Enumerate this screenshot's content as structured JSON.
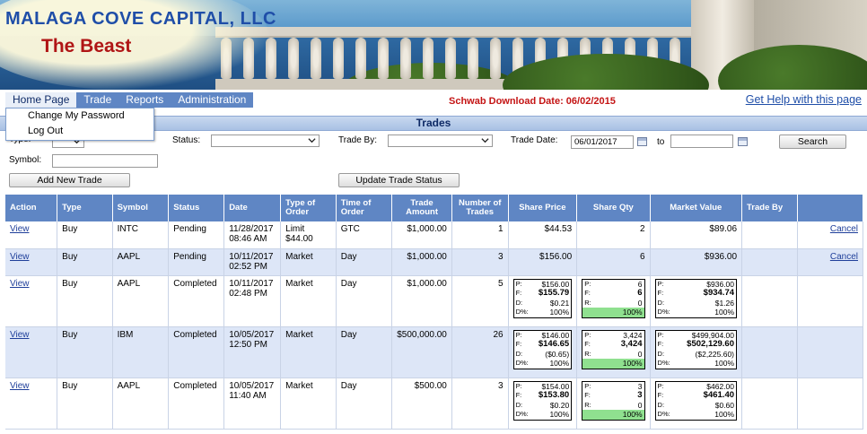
{
  "header": {
    "company": "MALAGA COVE CAPITAL, LLC",
    "app_title": "The Beast",
    "download_date": "Schwab Download Date: 06/02/2015",
    "help_link": "Get Help with this page"
  },
  "nav": {
    "items": [
      "Home Page",
      "Trade",
      "Reports",
      "Administration"
    ],
    "dropdown": [
      "Change My Password",
      "Log Out"
    ]
  },
  "trades_panel": {
    "title": "Trades",
    "type_label": "Type:",
    "symbol_label": "Symbol:",
    "status_label": "Status:",
    "trade_by_label": "Trade By:",
    "trade_date_label": "Trade Date:",
    "trade_date_from": "06/01/2017",
    "to_label": "to",
    "search_button": "Search",
    "add_button": "Add New Trade",
    "update_button": "Update Trade Status"
  },
  "table": {
    "headers": [
      "Action",
      "Type",
      "Symbol",
      "Status",
      "Date",
      "Type of Order",
      "Time of Order",
      "Trade Amount",
      "Number of Trades",
      "Share Price",
      "Share Qty",
      "Market Value",
      "Trade By",
      ""
    ],
    "rows": [
      {
        "action": "View",
        "type": "Buy",
        "symbol": "INTC",
        "status": "Pending",
        "date": "11/28/2017",
        "time": "08:46 AM",
        "order_type": "Limit",
        "order_extra": "$44.00",
        "time_of_order": "GTC",
        "amount": "$1,000.00",
        "num_trades": "1",
        "simple": true,
        "share_price": "$44.53",
        "share_qty": "2",
        "market_value": "$89.06",
        "trade_by": "",
        "cancel": "Cancel"
      },
      {
        "action": "View",
        "type": "Buy",
        "symbol": "AAPL",
        "status": "Pending",
        "date": "10/11/2017",
        "time": "02:52 PM",
        "order_type": "Market",
        "order_extra": "",
        "time_of_order": "Day",
        "amount": "$1,000.00",
        "num_trades": "3",
        "simple": true,
        "share_price": "$156.00",
        "share_qty": "6",
        "market_value": "$936.00",
        "trade_by": "",
        "cancel": "Cancel"
      },
      {
        "action": "View",
        "type": "Buy",
        "symbol": "AAPL",
        "status": "Completed",
        "date": "10/11/2017",
        "time": "02:48 PM",
        "order_type": "Market",
        "order_extra": "",
        "time_of_order": "Day",
        "amount": "$1,000.00",
        "num_trades": "5",
        "simple": false,
        "price_box": {
          "p": "$156.00",
          "f": "$155.79",
          "d": "$0.21",
          "pct": "100%"
        },
        "qty_box": {
          "p": "6",
          "f": "6",
          "r": "0",
          "pct": "100%"
        },
        "mv_box": {
          "p": "$936.00",
          "f": "$934.74",
          "d": "$1.26",
          "pct": "100%"
        },
        "trade_by": "",
        "cancel": ""
      },
      {
        "action": "View",
        "type": "Buy",
        "symbol": "IBM",
        "status": "Completed",
        "date": "10/05/2017",
        "time": "12:50 PM",
        "order_type": "Market",
        "order_extra": "",
        "time_of_order": "Day",
        "amount": "$500,000.00",
        "num_trades": "26",
        "simple": false,
        "price_box": {
          "p": "$146.00",
          "f": "$146.65",
          "d": "($0.65)",
          "pct": "100%"
        },
        "qty_box": {
          "p": "3,424",
          "f": "3,424",
          "r": "0",
          "pct": "100%"
        },
        "mv_box": {
          "p": "$499,904.00",
          "f": "$502,129.60",
          "d": "($2,225.60)",
          "pct": "100%"
        },
        "trade_by": "",
        "cancel": ""
      },
      {
        "action": "View",
        "type": "Buy",
        "symbol": "AAPL",
        "status": "Completed",
        "date": "10/05/2017",
        "time": "11:40 AM",
        "order_type": "Market",
        "order_extra": "",
        "time_of_order": "Day",
        "amount": "$500.00",
        "num_trades": "3",
        "simple": false,
        "price_box": {
          "p": "$154.00",
          "f": "$153.80",
          "d": "$0.20",
          "pct": "100%"
        },
        "qty_box": {
          "p": "3",
          "f": "3",
          "r": "0",
          "pct": "100%"
        },
        "mv_box": {
          "p": "$462.00",
          "f": "$461.40",
          "d": "$0.60",
          "pct": "100%"
        },
        "trade_by": "",
        "cancel": ""
      }
    ],
    "box_labels": {
      "p": "P:",
      "f": "F:",
      "d": "D:",
      "r": "R:",
      "dpct": "D%:"
    }
  },
  "colors": {
    "nav_bg": "#5f86c4",
    "header_bg": "#5f86c4",
    "row_alt": "#dde6f7",
    "pct_fill": "#8fe08f",
    "company": "#1f4ea8",
    "beast": "#b01515",
    "download": "#c41414"
  }
}
